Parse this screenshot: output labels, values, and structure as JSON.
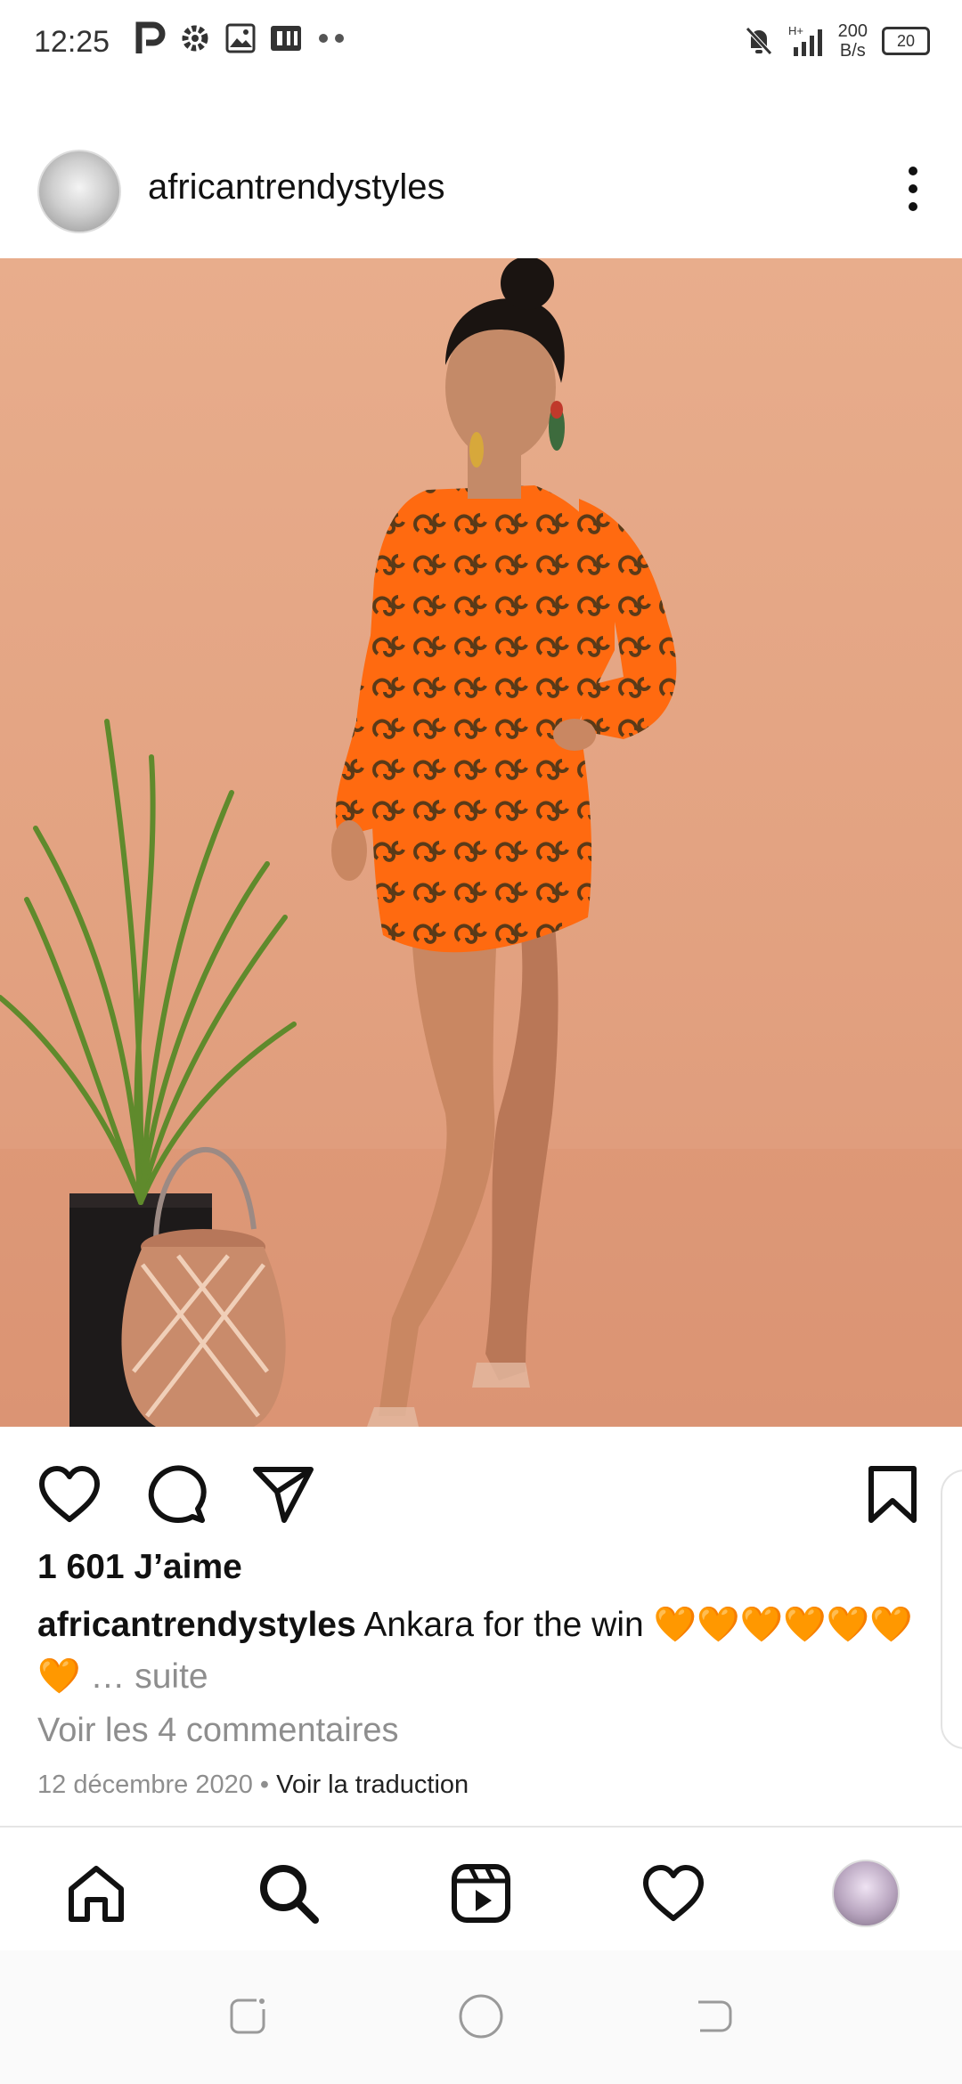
{
  "status_bar": {
    "time": "12:25",
    "speed_value": "200",
    "speed_unit": "B/s",
    "battery": "20",
    "left_icons": [
      "p-icon",
      "gear-icon",
      "gallery-icon",
      "pdf-icon",
      "more-dots-icon"
    ],
    "right_icons": [
      "mute-icon",
      "signal-icon"
    ]
  },
  "post": {
    "username": "africantrendystyles",
    "likes": "1 601 J’aime",
    "caption_user": "africantrendystyles",
    "caption_text": "Ankara for the win 🧡🧡🧡🧡🧡🧡🧡",
    "caption_more": "… suite",
    "comments_link": "Voir les 4 commentaires",
    "date": "12 décembre 2020",
    "separator": "•",
    "translate": "Voir la traduction"
  },
  "colors": {
    "photo_background": "#e2a180",
    "dress_orange": "#ff6a10",
    "text_secondary": "#8e8e8e"
  },
  "bottom_nav": {
    "items": [
      "home-icon",
      "search-icon",
      "reels-icon",
      "heart-icon",
      "profile-avatar"
    ]
  }
}
